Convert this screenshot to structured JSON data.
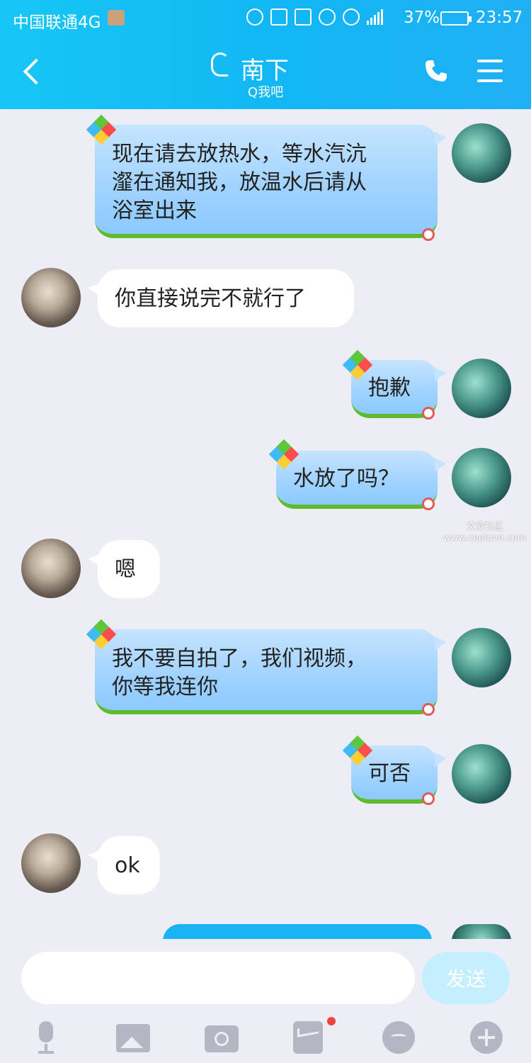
{
  "status_bar": {
    "carrier": "中国联通4G",
    "battery": "37%",
    "time": "23:57"
  },
  "header": {
    "title": "南下",
    "subtitle": "Q我吧",
    "icons": [
      "back-arrow-icon",
      "ear-icon",
      "phone-icon",
      "menu-icon"
    ]
  },
  "messages": [
    {
      "sender": "me",
      "text": "现在请去放热水，等水汽沆\n瀣在通知我，放温水后请从\n浴室出来"
    },
    {
      "sender": "other",
      "text": "你直接说完不就行了"
    },
    {
      "sender": "me",
      "text": "抱歉"
    },
    {
      "sender": "me",
      "text": "水放了吗？"
    },
    {
      "sender": "other",
      "text": "嗯"
    },
    {
      "sender": "me",
      "text": "我不要自拍了，我们视频，\n你等我连你"
    },
    {
      "sender": "me",
      "text": "可否"
    },
    {
      "sender": "other",
      "text": "ok"
    }
  ],
  "watermark": {
    "line1": "文爱社区",
    "line2": "www.ceelove.com"
  },
  "composer": {
    "input_value": "",
    "send_label": "发送"
  },
  "toolbar": [
    "microphone-icon",
    "image-icon",
    "camera-icon",
    "red-packet-icon",
    "emoji-icon",
    "plus-icon"
  ],
  "colors": {
    "header": "#12b6f4",
    "my_bubble": "#a8d8ff",
    "bubble_grass": "#5dbb2c",
    "background": "#ededf5",
    "send_button": "#c5eefe"
  }
}
